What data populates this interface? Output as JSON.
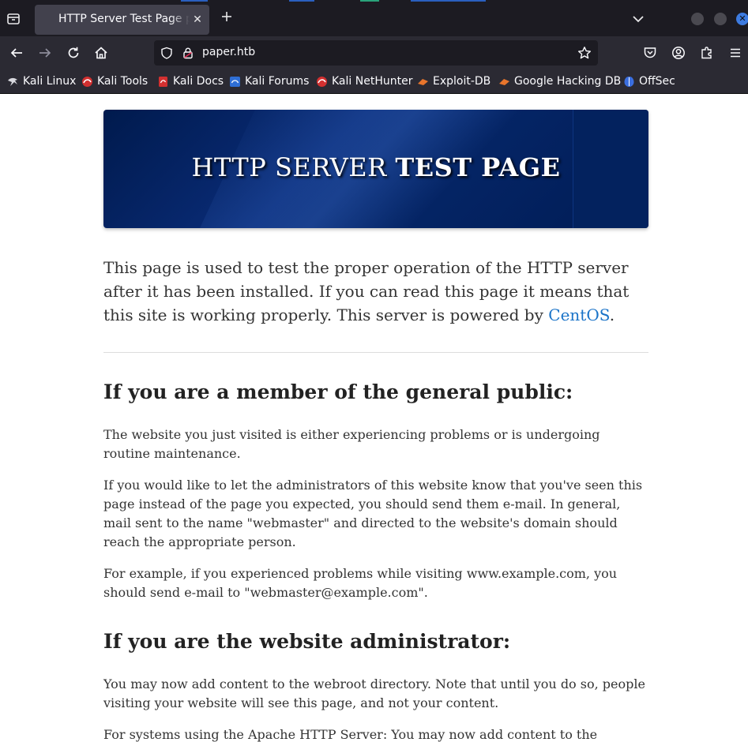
{
  "browser": {
    "tab_title": "HTTP Server Test Page powered by CentOS",
    "url": "paper.htb",
    "bookmarks": [
      {
        "label": "Kali Linux",
        "icon": "kali-dragon-icon"
      },
      {
        "label": "Kali Tools",
        "icon": "kali-tools-icon"
      },
      {
        "label": "Kali Docs",
        "icon": "kali-docs-icon"
      },
      {
        "label": "Kali Forums",
        "icon": "kali-forums-icon"
      },
      {
        "label": "Kali NetHunter",
        "icon": "kali-nethunter-icon"
      },
      {
        "label": "Exploit-DB",
        "icon": "exploit-db-icon"
      },
      {
        "label": "Google Hacking DB",
        "icon": "ghdb-icon"
      },
      {
        "label": "OffSec",
        "icon": "offsec-icon"
      }
    ],
    "colors": {
      "chrome_dark": "#1c1b22",
      "toolbar": "#2b2a33",
      "tab_active": "#42414d",
      "close_accent": "#3d7be0"
    }
  },
  "page": {
    "banner": {
      "title_plain": "HTTP SERVER ",
      "title_bold": "TEST PAGE"
    },
    "lead": {
      "text": "This page is used to test the proper operation of the HTTP server after it has been installed. If you can read this page it means that this site is working properly. This server is powered by ",
      "link": "CentOS",
      "end": "."
    },
    "public": {
      "heading": "If you are a member of the general public:",
      "p1": "The website you just visited is either experiencing problems or is undergoing routine maintenance.",
      "p2": "If you would like to let the administrators of this website know that you've seen this page instead of the page you expected, you should send them e-mail. In general, mail sent to the name \"webmaster\" and directed to the website's domain should reach the appropriate person.",
      "p3": "For example, if you experienced problems while visiting www.example.com, you should send e-mail to \"webmaster@example.com\"."
    },
    "admin": {
      "heading": "If you are the website administrator:",
      "p1": "You may now add content to the webroot directory. Note that until you do so, people visiting your website will see this page, and not your content.",
      "p2": "For systems using the Apache HTTP Server: You may now add content to the"
    },
    "colors": {
      "link": "#1a73c8",
      "banner": "#0a2c78"
    }
  }
}
